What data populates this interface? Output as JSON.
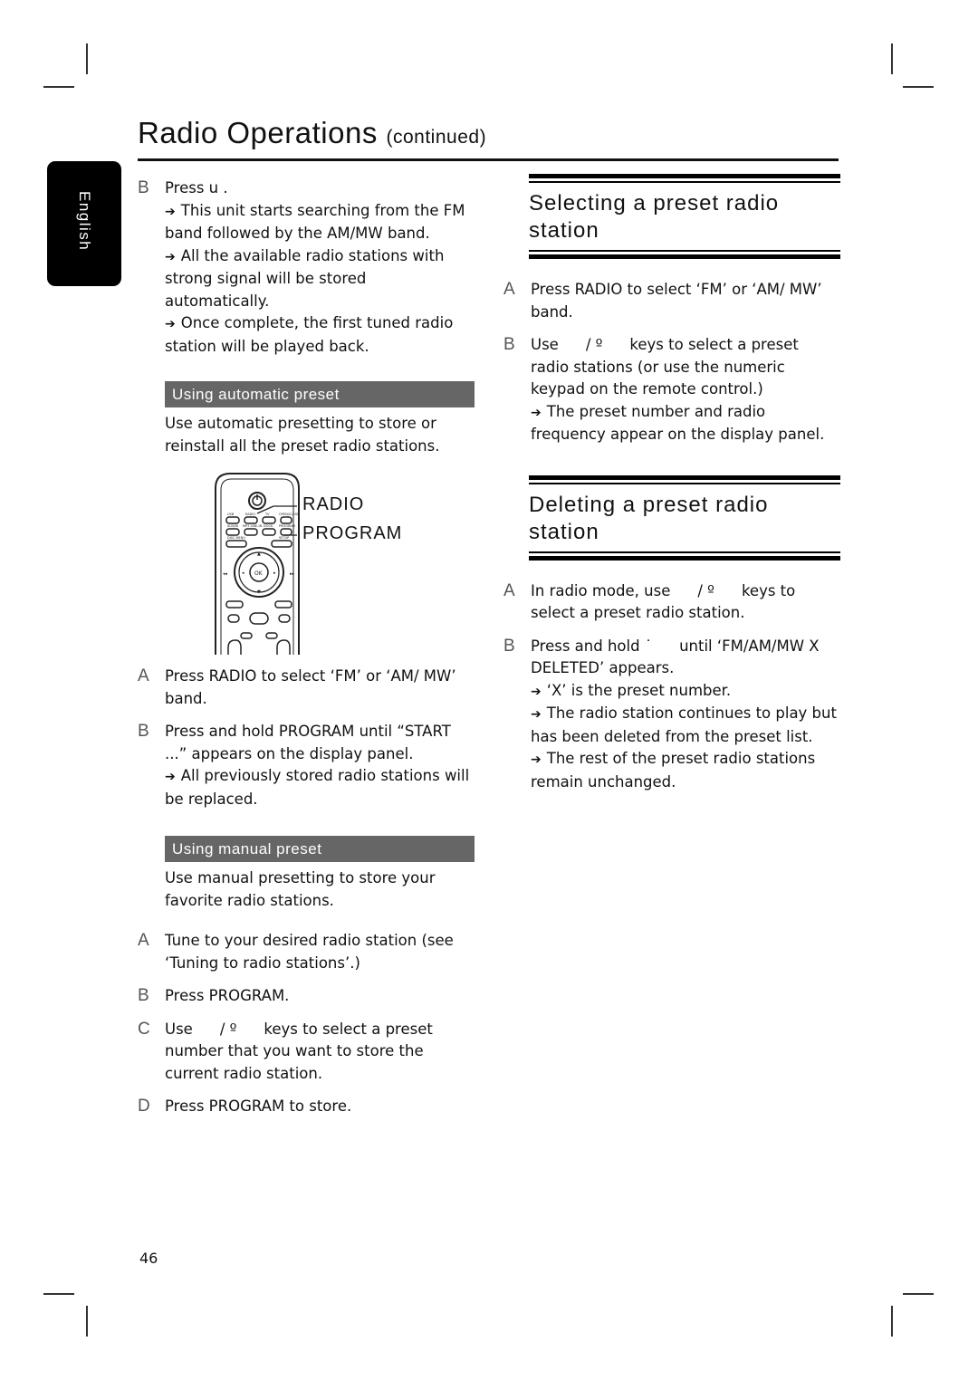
{
  "header": {
    "title": "Radio Operations",
    "title_suffix": "(continued)"
  },
  "language_tab": "English",
  "left_column": {
    "step_b_top": {
      "letter": "B",
      "text": "Press u   .",
      "results": [
        "This unit starts searching from the FM band followed by the AM/MW band.",
        "All the available radio stations with strong signal will be stored automatically.",
        "Once complete, the first tuned radio station will be played back."
      ]
    },
    "auto_preset": {
      "heading": "Using automatic preset",
      "intro": "Use automatic presetting to store or reinstall all the preset radio stations.",
      "remote_labels": [
        "RADIO",
        "PROGRAM"
      ],
      "remote_buttons": {
        "ok": "OK"
      },
      "steps": [
        {
          "letter": "A",
          "text": "Press RADIO to select ‘FM’ or ‘AM/ MW’ band."
        },
        {
          "letter": "B",
          "text": "Press and hold PROGRAM until “START ...” appears on the display panel.",
          "result": "All previously stored radio stations will be replaced."
        }
      ]
    },
    "manual_preset": {
      "heading": "Using manual preset",
      "intro": "Use manual presetting to store your favorite radio stations.",
      "steps": [
        {
          "letter": "A",
          "text": "Tune to your desired radio station (see ‘Tuning to radio stations’.)"
        },
        {
          "letter": "B",
          "text": "Press PROGRAM."
        },
        {
          "letter": "C",
          "text_pre": "Use",
          "text_keys": "/ º",
          "text_post": "keys to select a preset number that you want to store the current radio station."
        },
        {
          "letter": "D",
          "text": "Press PROGRAM to store."
        }
      ]
    }
  },
  "right_column": {
    "selecting": {
      "heading": "Selecting a preset radio station",
      "steps": [
        {
          "letter": "A",
          "text": "Press RADIO to select ‘FM’ or ‘AM/ MW’ band."
        },
        {
          "letter": "B",
          "text_pre": "Use",
          "text_keys": "/ º",
          "text_post": "keys to select a preset radio stations (or use the numeric keypad on the remote control.)",
          "result": "The preset number and radio frequency appear on the display panel."
        }
      ]
    },
    "deleting": {
      "heading": "Deleting a preset radio station",
      "steps": [
        {
          "letter": "A",
          "text_pre": "In radio mode, use",
          "text_keys": "/ º",
          "text_post": "keys to select a preset radio station."
        },
        {
          "letter": "B",
          "text_pre": "Press and hold",
          "text_keys": "˙",
          "text_post": "until ‘FM/AM/MW X DELETED’ appears.",
          "results": [
            "‘X’ is the preset number.",
            "The radio station continues to play but has been deleted from the preset list.",
            "The rest of the preset radio stations remain unchanged."
          ]
        }
      ]
    }
  },
  "page_number": "46",
  "arrow_glyph": "➔"
}
